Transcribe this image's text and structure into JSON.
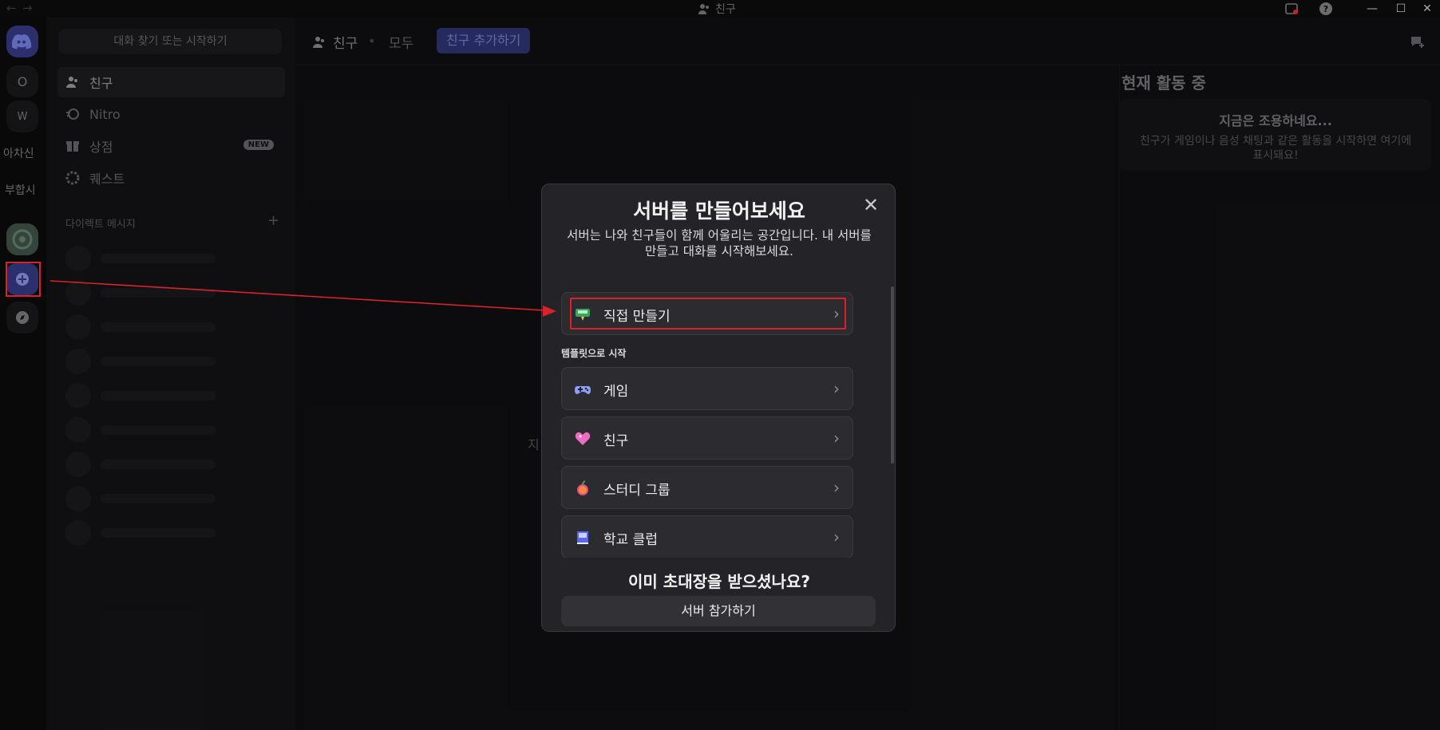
{
  "titlebar": {
    "back": "←",
    "forward": "→",
    "title": "친구",
    "minimize": "—",
    "maximize": "☐",
    "close": "✕"
  },
  "rail": {
    "items": [
      {
        "label": "O"
      },
      {
        "label": "W"
      },
      {
        "label": "아차신"
      },
      {
        "label": "부합시"
      }
    ]
  },
  "sidebar": {
    "search_placeholder": "대화 찾기 또는 시작하기",
    "nav": [
      {
        "label": "친구"
      },
      {
        "label": "Nitro"
      },
      {
        "label": "상점",
        "badge": "NEW"
      },
      {
        "label": "퀘스트"
      }
    ],
    "dm_header": "다이렉트 메시지",
    "dm_add": "+"
  },
  "topbar": {
    "title": "친구",
    "separator": "•",
    "all_tab": "모두",
    "add_friend": "친구 추가하기"
  },
  "main": {
    "hidden_text": "지"
  },
  "active_now": {
    "title": "현재 활동 중",
    "empty_title": "지금은 조용하네요...",
    "empty_body": "친구가 게임이나 음성 채팅과 같은 활동을 시작하면 여기에 표시돼요!"
  },
  "modal": {
    "title": "서버를 만들어보세요",
    "close": "✕",
    "subtitle": "서버는 나와 친구들이 함께 어울리는 공간입니다. 내 서버를 만들고 대화를 시작해보세요.",
    "create_own": "직접 만들기",
    "templates_header": "템플릿으로 시작",
    "templates": [
      {
        "label": "게임",
        "icon": "gamepad-icon"
      },
      {
        "label": "친구",
        "icon": "heart-icon"
      },
      {
        "label": "스터디 그룹",
        "icon": "apple-icon"
      },
      {
        "label": "학교 클럽",
        "icon": "book-icon"
      }
    ],
    "chevron": "›",
    "invite_title": "이미 초대장을 받으셨나요?",
    "join_button": "서버 참가하기"
  },
  "colors": {
    "annotation": "#d8232a",
    "brand": "#5865f2"
  }
}
